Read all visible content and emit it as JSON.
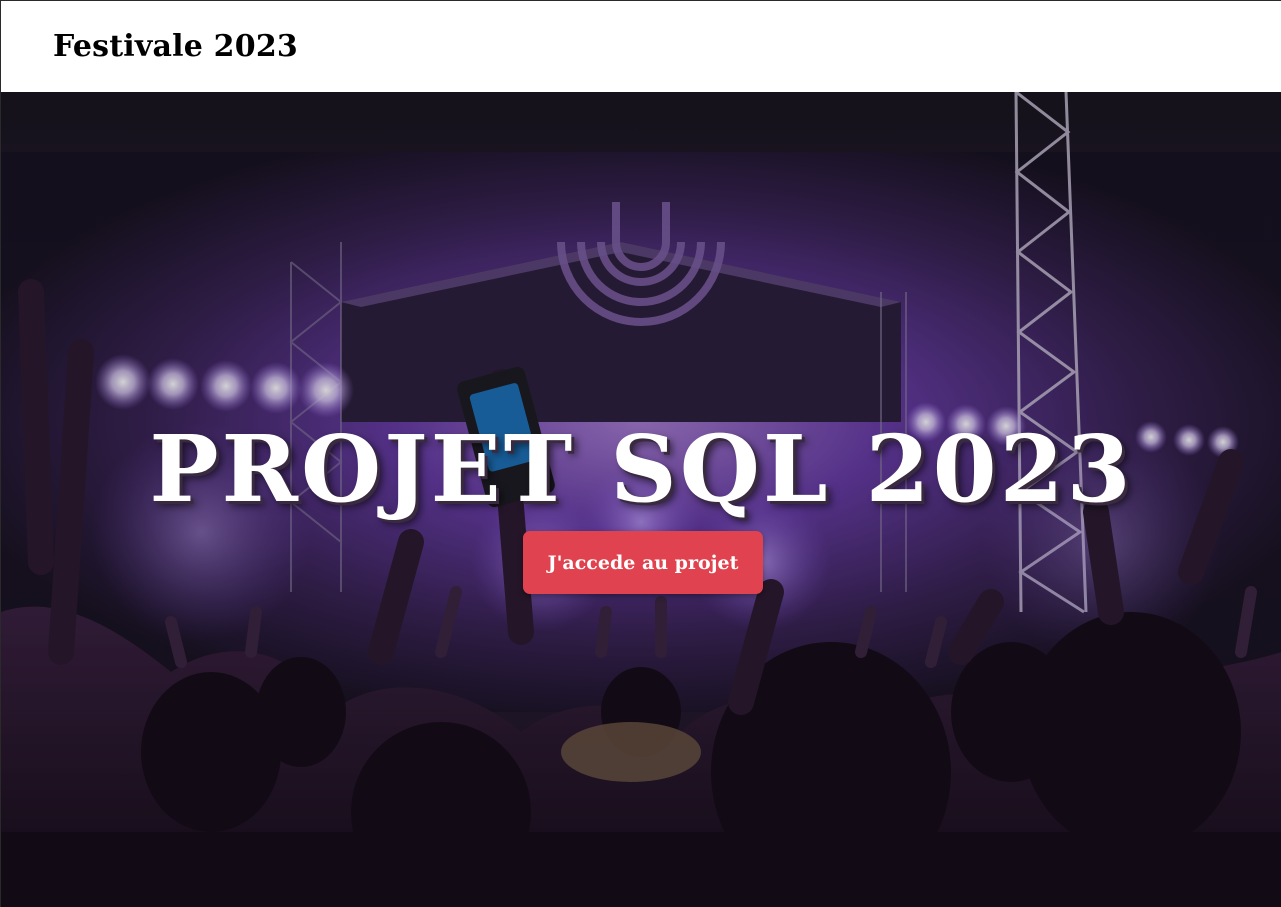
{
  "navbar": {
    "brand": "Festivale 2023"
  },
  "hero": {
    "title": "PROJET SQL 2023",
    "cta_label": "J'accede au projet",
    "background_image": "concert-crowd-stage-purple-lights"
  },
  "colors": {
    "cta_background": "#e0434f",
    "hero_tint": "#7b3fc4",
    "navbar_background": "#ffffff"
  }
}
